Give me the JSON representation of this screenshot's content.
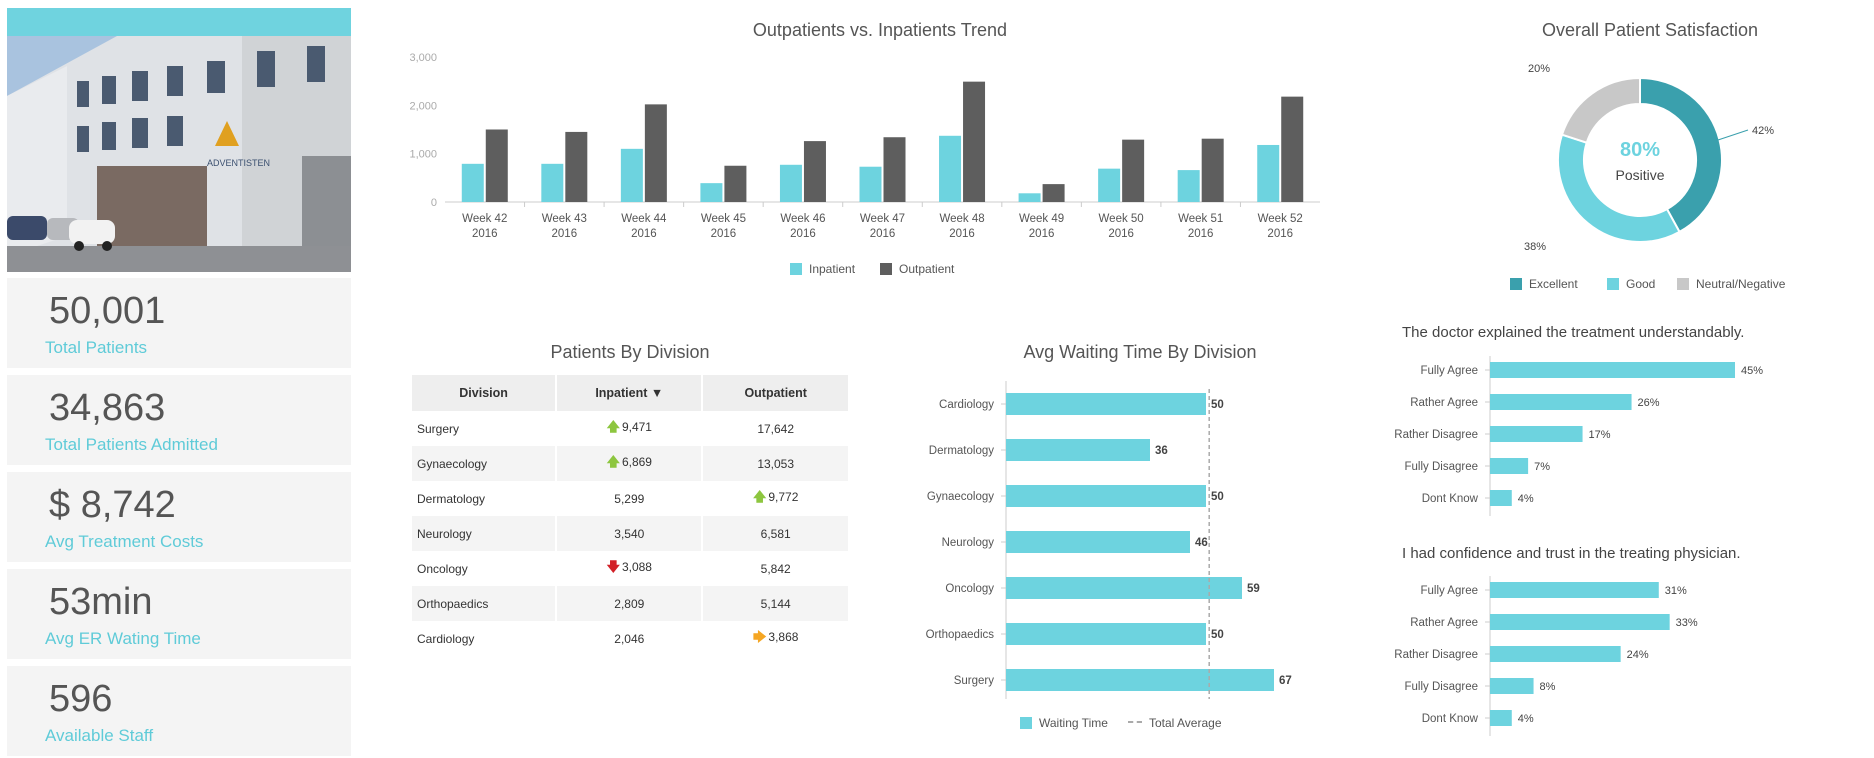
{
  "colors": {
    "teal": "#6dd3df",
    "dark": "#5e5e5e",
    "excellent": "#3aa0ad",
    "good": "#6dd3df",
    "neutral": "#c8c8c8",
    "up": "#8dc63f",
    "down": "#d22027",
    "side": "#f5a623"
  },
  "kpis": [
    {
      "value": "50,001",
      "label": "Total Patients"
    },
    {
      "value": "34,863",
      "label": "Total Patients Admitted"
    },
    {
      "value": "$ 8,742",
      "label": "Avg Treatment Costs"
    },
    {
      "value": "53min",
      "label": "Avg ER Wating Time"
    },
    {
      "value": "596",
      "label": "Available Staff"
    }
  ],
  "trend": {
    "title": "Outpatients vs. Inpatients Trend",
    "legend": {
      "inpatient": "Inpatient",
      "outpatient": "Outpatient"
    },
    "y_ticks": [
      "0",
      "1,000",
      "2,000",
      "3,000"
    ]
  },
  "satisfaction": {
    "title": "Overall Patient Satisfaction",
    "center_value": "80%",
    "center_label": "Positive",
    "labels": {
      "neutral": "20%",
      "excellent": "42%",
      "good": "38%"
    },
    "legend": {
      "excellent": "Excellent",
      "good": "Good",
      "neutral": "Neutral/Negative"
    }
  },
  "division_table": {
    "title": "Patients By Division",
    "headers": [
      "Division",
      "Inpatient ▼",
      "Outpatient"
    ],
    "rows": [
      {
        "division": "Surgery",
        "inpatient": "9,471",
        "outpatient": "17,642"
      },
      {
        "division": "Gynaecology",
        "inpatient": "6,869",
        "outpatient": "13,053"
      },
      {
        "division": "Dermatology",
        "inpatient": "5,299",
        "outpatient": "9,772"
      },
      {
        "division": "Neurology",
        "inpatient": "3,540",
        "outpatient": "6,581"
      },
      {
        "division": "Oncology",
        "inpatient": "3,088",
        "outpatient": "5,842"
      },
      {
        "division": "Orthopaedics",
        "inpatient": "2,809",
        "outpatient": "5,144"
      },
      {
        "division": "Cardiology",
        "inpatient": "2,046",
        "outpatient": "3,868"
      }
    ],
    "arrows": {
      "up": "🡅",
      "down": "🡇",
      "right": "🡆"
    }
  },
  "waiting": {
    "title": "Avg Waiting Time By Division",
    "legend": {
      "bars": "Waiting Time",
      "line": "Total Average"
    }
  },
  "survey1": {
    "title": "The doctor explained the treatment understandably."
  },
  "survey2": {
    "title": "I had confidence and trust in the treating physician."
  },
  "chart_data": [
    {
      "type": "bar",
      "title": "Outpatients vs. Inpatients Trend",
      "categories": [
        "Week 42 2016",
        "Week 43 2016",
        "Week 44 2016",
        "Week 45 2016",
        "Week 46 2016",
        "Week 47 2016",
        "Week 48 2016",
        "Week 49 2016",
        "Week 50 2016",
        "Week 51 2016",
        "Week 52 2016"
      ],
      "series": [
        {
          "name": "Inpatient",
          "values": [
            790,
            790,
            1100,
            390,
            770,
            730,
            1370,
            180,
            690,
            660,
            1180
          ]
        },
        {
          "name": "Outpatient",
          "values": [
            1500,
            1450,
            2020,
            750,
            1260,
            1340,
            2490,
            370,
            1290,
            1310,
            2180
          ]
        }
      ],
      "ylim": [
        0,
        3000
      ]
    },
    {
      "type": "pie",
      "title": "Overall Patient Satisfaction",
      "categories": [
        "Excellent",
        "Good",
        "Neutral/Negative"
      ],
      "values": [
        42,
        38,
        20
      ]
    },
    {
      "type": "table",
      "title": "Patients By Division",
      "columns": [
        "Division",
        "Inpatient",
        "Outpatient"
      ],
      "rows": [
        [
          "Surgery",
          9471,
          17642
        ],
        [
          "Gynaecology",
          6869,
          13053
        ],
        [
          "Dermatology",
          5299,
          9772
        ],
        [
          "Neurology",
          3540,
          6581
        ],
        [
          "Oncology",
          3088,
          5842
        ],
        [
          "Orthopaedics",
          2809,
          5144
        ],
        [
          "Cardiology",
          2046,
          3868
        ]
      ]
    },
    {
      "type": "bar",
      "orientation": "horizontal",
      "title": "Avg Waiting Time By Division",
      "categories": [
        "Cardiology",
        "Dermatology",
        "Gynaecology",
        "Neurology",
        "Oncology",
        "Orthopaedics",
        "Surgery"
      ],
      "series": [
        {
          "name": "Waiting Time",
          "values": [
            50,
            36,
            50,
            46,
            59,
            50,
            67
          ]
        }
      ],
      "total_average": 50.8
    },
    {
      "type": "bar",
      "orientation": "horizontal",
      "title": "The doctor explained the treatment understandably.",
      "categories": [
        "Fully Agree",
        "Rather Agree",
        "Rather Disagree",
        "Fully Disagree",
        "Dont Know"
      ],
      "values": [
        45,
        26,
        17,
        7,
        4
      ],
      "labels": [
        "45%",
        "26%",
        "17%",
        "7%",
        "4%"
      ]
    },
    {
      "type": "bar",
      "orientation": "horizontal",
      "title": "I had confidence and trust in the treating physician.",
      "categories": [
        "Fully Agree",
        "Rather Agree",
        "Rather Disagree",
        "Fully Disagree",
        "Dont Know"
      ],
      "values": [
        31,
        33,
        24,
        8,
        4
      ],
      "labels": [
        "31%",
        "33%",
        "24%",
        "8%",
        "4%"
      ]
    }
  ]
}
